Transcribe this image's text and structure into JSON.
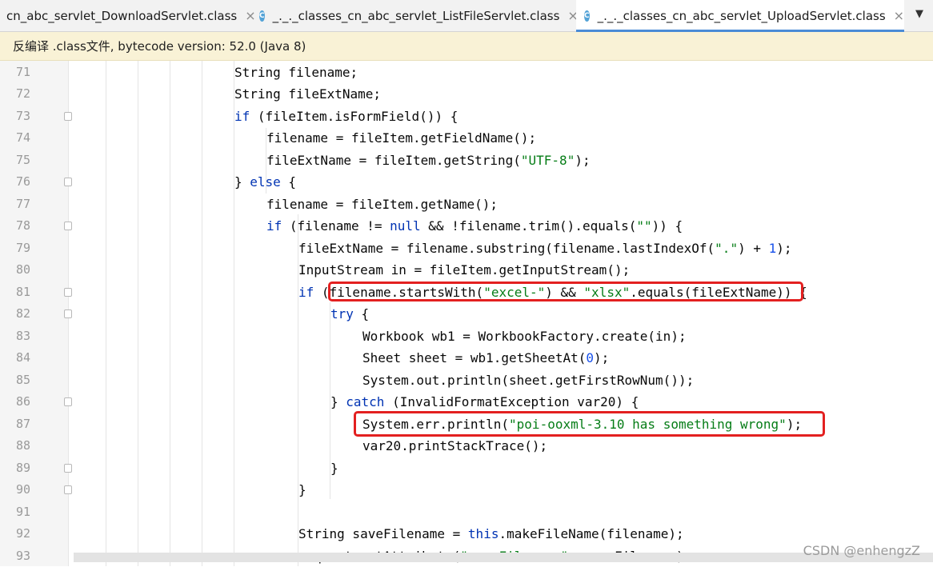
{
  "tabs": [
    {
      "label": "cn_abc_servlet_DownloadServlet.class",
      "icon": "class-icon",
      "active": false
    },
    {
      "label": "_._._classes_cn_abc_servlet_ListFileServlet.class",
      "icon": "class-icon",
      "active": false
    },
    {
      "label": "_._._classes_cn_abc_servlet_UploadServlet.class",
      "icon": "class-icon",
      "active": true
    }
  ],
  "icon_letter": "C",
  "close_glyph": "×",
  "banner": {
    "text": "反编译 .class文件, bytecode version: 52.0 (Java 8)"
  },
  "colors": {
    "keyword": "#0033b3",
    "string": "#067d17",
    "number": "#1750eb",
    "highlight_box": "#e32020",
    "banner_bg": "#f9f2d6",
    "active_tab_underline": "#4a8bd6"
  },
  "code_lines": [
    {
      "num": "71",
      "indent": 5,
      "tokens": [
        [
          "p",
          "String filename;"
        ]
      ]
    },
    {
      "num": "72",
      "indent": 5,
      "tokens": [
        [
          "p",
          "String fileExtName;"
        ]
      ]
    },
    {
      "num": "73",
      "indent": 5,
      "fold": true,
      "tokens": [
        [
          "k",
          "if"
        ],
        [
          "p",
          " (fileItem.isFormField()) {"
        ]
      ]
    },
    {
      "num": "74",
      "indent": 6,
      "tokens": [
        [
          "p",
          "filename = fileItem.getFieldName();"
        ]
      ]
    },
    {
      "num": "75",
      "indent": 6,
      "tokens": [
        [
          "p",
          "fileExtName = fileItem.getString("
        ],
        [
          "s",
          "\"UTF-8\""
        ],
        [
          "p",
          ");"
        ]
      ]
    },
    {
      "num": "76",
      "indent": 5,
      "fold": true,
      "tokens": [
        [
          "p",
          "} "
        ],
        [
          "k",
          "else"
        ],
        [
          "p",
          " {"
        ]
      ]
    },
    {
      "num": "77",
      "indent": 6,
      "tokens": [
        [
          "p",
          "filename = fileItem.getName();"
        ]
      ]
    },
    {
      "num": "78",
      "indent": 6,
      "fold": true,
      "tokens": [
        [
          "k",
          "if"
        ],
        [
          "p",
          " (filename != "
        ],
        [
          "k",
          "null"
        ],
        [
          "p",
          " && !filename.trim().equals("
        ],
        [
          "s",
          "\"\""
        ],
        [
          "p",
          ")) {"
        ]
      ]
    },
    {
      "num": "79",
      "indent": 7,
      "tokens": [
        [
          "p",
          "fileExtName = filename.substring(filename.lastIndexOf("
        ],
        [
          "s",
          "\".\""
        ],
        [
          "p",
          ") + "
        ],
        [
          "n",
          "1"
        ],
        [
          "p",
          ");"
        ]
      ]
    },
    {
      "num": "80",
      "indent": 7,
      "tokens": [
        [
          "p",
          "InputStream in = fileItem.getInputStream();"
        ]
      ]
    },
    {
      "num": "81",
      "indent": 7,
      "fold": true,
      "tokens": [
        [
          "k",
          "if"
        ],
        [
          "p",
          " (filename.startsWith("
        ],
        [
          "s",
          "\"excel-\""
        ],
        [
          "p",
          ") && "
        ],
        [
          "s",
          "\"xlsx\""
        ],
        [
          "p",
          ".equals(fileExtName)) {"
        ]
      ]
    },
    {
      "num": "82",
      "indent": 8,
      "fold": true,
      "tokens": [
        [
          "k",
          "try"
        ],
        [
          "p",
          " {"
        ]
      ]
    },
    {
      "num": "83",
      "indent": 9,
      "tokens": [
        [
          "p",
          "Workbook wb1 = WorkbookFactory.create(in);"
        ]
      ]
    },
    {
      "num": "84",
      "indent": 9,
      "tokens": [
        [
          "p",
          "Sheet sheet = wb1.getSheetAt("
        ],
        [
          "n",
          "0"
        ],
        [
          "p",
          ");"
        ]
      ]
    },
    {
      "num": "85",
      "indent": 9,
      "tokens": [
        [
          "p",
          "System.out.println(sheet.getFirstRowNum());"
        ]
      ]
    },
    {
      "num": "86",
      "indent": 8,
      "fold": true,
      "tokens": [
        [
          "p",
          "} "
        ],
        [
          "k",
          "catch"
        ],
        [
          "p",
          " (InvalidFormatException var20) {"
        ]
      ]
    },
    {
      "num": "87",
      "indent": 9,
      "tokens": [
        [
          "p",
          "System.err.println("
        ],
        [
          "s",
          "\"poi-ooxml-3.10 has something wrong\""
        ],
        [
          "p",
          ");"
        ]
      ]
    },
    {
      "num": "88",
      "indent": 9,
      "tokens": [
        [
          "p",
          "var20.printStackTrace();"
        ]
      ]
    },
    {
      "num": "89",
      "indent": 8,
      "fold": true,
      "tokens": [
        [
          "p",
          "}"
        ]
      ]
    },
    {
      "num": "90",
      "indent": 7,
      "fold": true,
      "tokens": [
        [
          "p",
          "}"
        ]
      ]
    },
    {
      "num": "91",
      "indent": 7,
      "tokens": []
    },
    {
      "num": "92",
      "indent": 7,
      "tokens": [
        [
          "p",
          "String saveFilename = "
        ],
        [
          "k",
          "this"
        ],
        [
          "p",
          ".makeFileName(filename);"
        ]
      ]
    },
    {
      "num": "93",
      "indent": 7,
      "tokens": [
        [
          "p",
          "request.setAttribute("
        ],
        [
          "s",
          "\"saveFilename\""
        ],
        [
          "p",
          ", saveFilename);"
        ]
      ]
    }
  ],
  "watermark": "CSDN @enhengzZ"
}
